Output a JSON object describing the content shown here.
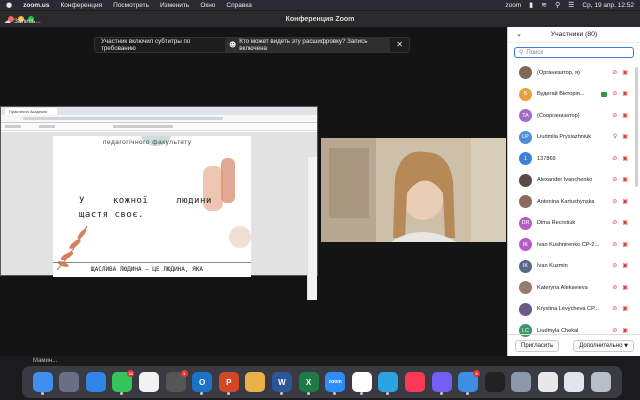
{
  "menubar": {
    "app_name": "zoom.us",
    "menus": [
      "Конференция",
      "Посмотреть",
      "Изменить",
      "Окно",
      "Справка"
    ],
    "right_app": "zoom",
    "datetime": "Ср, 19 апр.  12:52"
  },
  "window": {
    "title": "Конференция Zoom"
  },
  "recording": {
    "label": "Запись..."
  },
  "caption_banner": {
    "message": "Участник включил субтитры по требованию",
    "who_link": "Кто может видеть эту расшифровку? Запись включена"
  },
  "shared_doc": {
    "tab_label": "Практична Академія",
    "faculty_line": "педагогічного факультету",
    "quote_line1": "У кожної людини",
    "quote_line2": "щастя своє.",
    "footnote": "ЩАСЛИВА ЛЮДИНА — ЦЕ ЛЮДИНА, ЯКА"
  },
  "participants": {
    "header": "Участники (80)",
    "search_placeholder": "Поиск",
    "items": [
      {
        "name": "(Организатор, я)",
        "initials": "",
        "color": "#7b6a5a",
        "mic": "off",
        "cam": "off"
      },
      {
        "name": "Будегай Вікторія...",
        "initials": "Б",
        "color": "#e8a13a",
        "mic": "off",
        "cam": "off",
        "rec": true
      },
      {
        "name": "(Соорганизатор)",
        "initials": "TA",
        "color": "#a36ac8",
        "mic": "off",
        "cam": "off"
      },
      {
        "name": "Liudmila Prysiazhniuk",
        "initials": "LP",
        "color": "#4f8fd6",
        "mic": "on",
        "cam": "off"
      },
      {
        "name": "137869",
        "initials": "1",
        "color": "#3b82d6",
        "mic": "off",
        "cam": "off"
      },
      {
        "name": "Alexander Ivanchenko",
        "initials": "",
        "color": "#5a4a44",
        "mic": "off",
        "cam": "off"
      },
      {
        "name": "Antonina Kartushynska",
        "initials": "",
        "color": "#8a6a5a",
        "mic": "off",
        "cam": "off"
      },
      {
        "name": "Dima Recrotiuk",
        "initials": "DR",
        "color": "#b75bc7",
        "mic": "off",
        "cam": "off"
      },
      {
        "name": "Ivan Kushnirenko CP-2...",
        "initials": "IK",
        "color": "#b75bc7",
        "mic": "off",
        "cam": "off"
      },
      {
        "name": "Ivan Kuzmin",
        "initials": "IK",
        "color": "#566a88",
        "mic": "off",
        "cam": "off"
      },
      {
        "name": "Kateryna Alekseieva",
        "initials": "",
        "color": "#9a7a6a",
        "mic": "off",
        "cam": "off"
      },
      {
        "name": "Krystina Levycheva CP...",
        "initials": "",
        "color": "#6a5a88",
        "mic": "off",
        "cam": "off"
      },
      {
        "name": "Liudmyla Chekal",
        "initials": "LC",
        "color": "#3c9a6a",
        "mic": "off",
        "cam": "off"
      }
    ],
    "invite_label": "Пригласить",
    "more_label": "Дополнительно"
  },
  "desktop": {
    "label": "Мамин..."
  },
  "dock": {
    "apps": [
      {
        "name": "finder",
        "color": "#3f8ef0",
        "badge": ""
      },
      {
        "name": "launchpad",
        "color": "#6b6f86",
        "badge": ""
      },
      {
        "name": "safari",
        "color": "#2f86e6",
        "badge": ""
      },
      {
        "name": "messages",
        "color": "#33c45a",
        "badge": "11"
      },
      {
        "name": "photos",
        "color": "#f2f2f2",
        "badge": ""
      },
      {
        "name": "chrome-dev",
        "color": "#555555",
        "badge": "1"
      },
      {
        "name": "outlook",
        "color": "#1a73c8",
        "badge": ""
      },
      {
        "name": "powerpoint",
        "color": "#d24726",
        "badge": ""
      },
      {
        "name": "photo-viewer",
        "color": "#e9b246",
        "badge": ""
      },
      {
        "name": "word",
        "color": "#2b5797",
        "badge": ""
      },
      {
        "name": "excel",
        "color": "#1d7a44",
        "badge": ""
      },
      {
        "name": "zoom",
        "color": "#2d8cff",
        "badge": ""
      },
      {
        "name": "chrome",
        "color": "#ffffff",
        "badge": ""
      },
      {
        "name": "telegram",
        "color": "#2aa3e0",
        "badge": ""
      },
      {
        "name": "music",
        "color": "#fa3a55",
        "badge": ""
      },
      {
        "name": "viber",
        "color": "#7360f2",
        "badge": ""
      },
      {
        "name": "mail",
        "color": "#3d8fe6",
        "badge": "2"
      },
      {
        "name": "terminal",
        "color": "#222222",
        "badge": ""
      },
      {
        "name": "preview",
        "color": "#8a98a8",
        "badge": ""
      },
      {
        "name": "document",
        "color": "#e8e8e8",
        "badge": ""
      },
      {
        "name": "image",
        "color": "#dfe6ee",
        "badge": ""
      },
      {
        "name": "trash",
        "color": "#b8bec6",
        "badge": ""
      }
    ],
    "labels": {
      "finder": "",
      "word": "W",
      "excel": "X",
      "powerpoint": "P",
      "outlook": "O",
      "zoom": "zoom"
    }
  }
}
